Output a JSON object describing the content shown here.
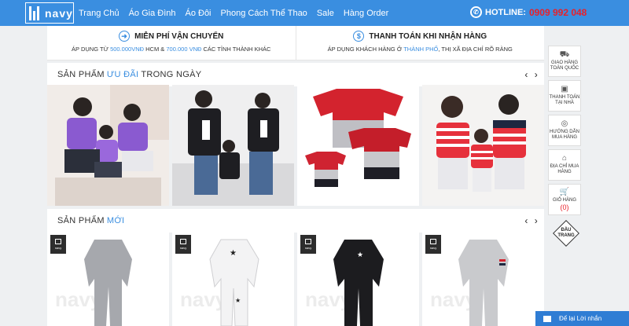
{
  "header": {
    "logo_text": "navy",
    "nav": [
      "Trang Chủ",
      "Áo Gia Đình",
      "Áo Đôi",
      "Phong Cách Thể Thao",
      "Sale",
      "Hàng Order"
    ],
    "hotline_label": "HOTLINE:",
    "hotline_number": "0909 992 048"
  },
  "policy": {
    "shipping_title": "MIỄN PHÍ VẬN CHUYỂN",
    "shipping_pre": "ÁP DỤNG TỪ ",
    "shipping_amt1": "500.000VNĐ",
    "shipping_mid": " HCM & ",
    "shipping_amt2": "700.000 VNĐ",
    "shipping_post": " CÁC TỈNH THÀNH KHÁC",
    "cod_title": "THANH TOÁN KHI NHẬN HÀNG",
    "cod_pre": "ÁP DỤNG KHÁCH HÀNG Ở ",
    "cod_hl": "THÀNH PHỐ",
    "cod_post": ", THỊ XÃ ĐỊA CHỈ RÕ RÀNG"
  },
  "sections": {
    "promo_pre": "SẢN PHẨM",
    "promo_hl": "ƯU ĐÃI",
    "promo_post": "TRONG NGÀY",
    "new_pre": "SẢN PHẨM",
    "new_hl": "MỚI",
    "prev": "‹",
    "next": "›"
  },
  "badge_text": "navy",
  "sidebar": [
    {
      "icon": "truck-icon",
      "glyph": "⛟",
      "label": "GIAO HÀNG TOÀN QUỐC"
    },
    {
      "icon": "money-icon",
      "glyph": "▣",
      "label": "THANH TOÁN TẠI NHÀ"
    },
    {
      "icon": "guide-icon",
      "glyph": "◎",
      "label": "HƯỚNG DẪN MUA HÀNG"
    },
    {
      "icon": "store-icon",
      "glyph": "⌂",
      "label": "ĐỊA CHỈ MUA HÀNG"
    },
    {
      "icon": "cart-icon",
      "glyph": "🛒",
      "label": "GIỎ HÀNG",
      "count": "(0)"
    }
  ],
  "totop": "ĐẦU TRANG",
  "chat": "Để lại Lời nhắn",
  "colors": {
    "brand": "#3a8ee0",
    "hotline": "#e8202a"
  }
}
